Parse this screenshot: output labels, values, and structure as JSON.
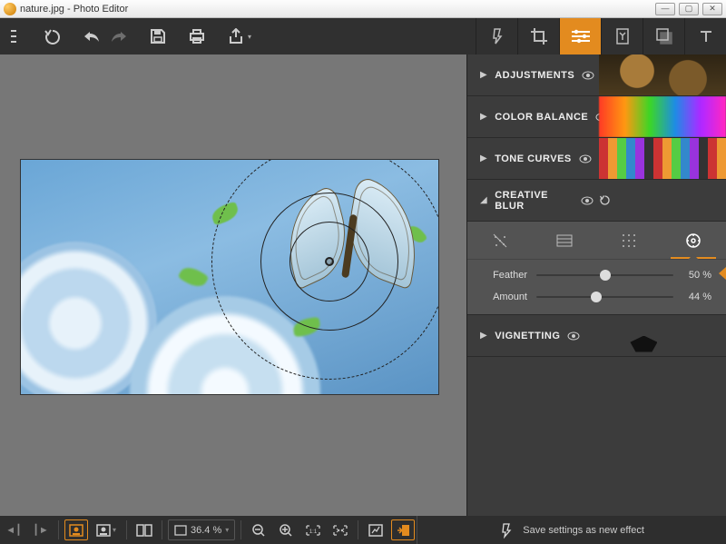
{
  "window": {
    "title": "nature.jpg - Photo Editor"
  },
  "mode_tabs": [
    "effects",
    "crop",
    "adjust",
    "presets",
    "overlay",
    "text"
  ],
  "active_mode_index": 2,
  "panels": {
    "adjustments": {
      "label": "ADJUSTMENTS"
    },
    "color_balance": {
      "label": "COLOR BALANCE"
    },
    "tone_curves": {
      "label": "TONE CURVES"
    },
    "creative_blur": {
      "label": "CREATIVE BLUR",
      "subtabs": [
        "radial-gradient",
        "linear",
        "grid",
        "circular"
      ],
      "active_subtab": 3,
      "sliders": {
        "feather": {
          "label": "Feather",
          "value": 50,
          "display": "50 %"
        },
        "amount": {
          "label": "Amount",
          "value": 44,
          "display": "44 %"
        }
      }
    },
    "vignetting": {
      "label": "VIGNETTING"
    }
  },
  "bottom": {
    "zoom_display": "36.4 %",
    "save_effect_label": "Save settings as new effect"
  }
}
